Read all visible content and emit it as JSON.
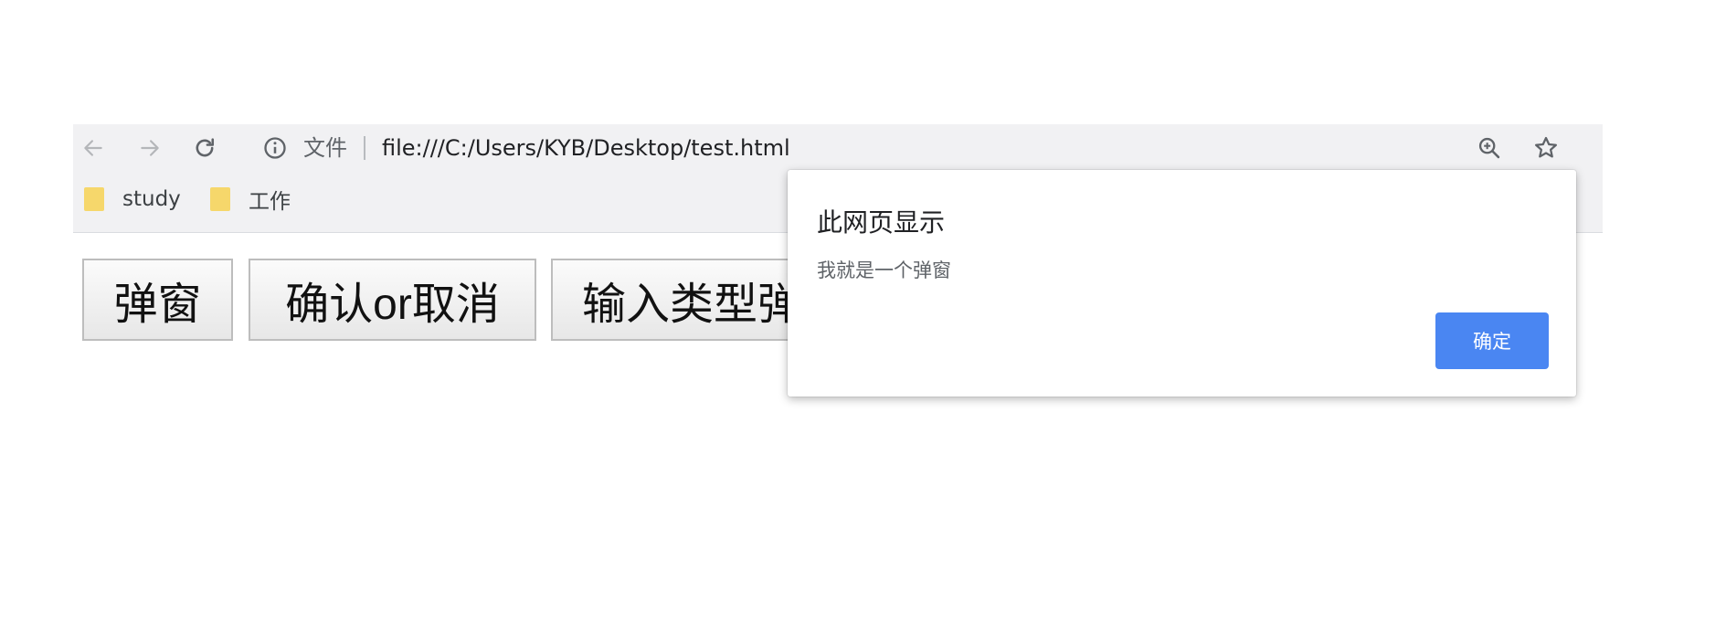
{
  "browser": {
    "toolbar": {
      "back_icon": "arrow-left-icon",
      "forward_icon": "arrow-right-icon",
      "reload_icon": "reload-icon",
      "info_icon": "info-icon",
      "scheme_label": "文件",
      "url": "file:///C:/Users/KYB/Desktop/test.html",
      "zoom_icon": "zoom-in-icon",
      "star_icon": "star-icon"
    },
    "bookmarks": [
      {
        "label": "study",
        "icon": "folder-icon"
      },
      {
        "label": "工作",
        "icon": "folder-icon"
      }
    ]
  },
  "page": {
    "buttons": [
      {
        "label": "弹窗"
      },
      {
        "label": "确认or取消"
      },
      {
        "label": "输入类型弹"
      }
    ]
  },
  "dialog": {
    "title": "此网页显示",
    "message": "我就是一个弹窗",
    "ok_label": "确定",
    "ok_color": "#4a86f2"
  },
  "colors": {
    "chrome_bg": "#f1f1f3",
    "folder": "#f6d76b"
  }
}
